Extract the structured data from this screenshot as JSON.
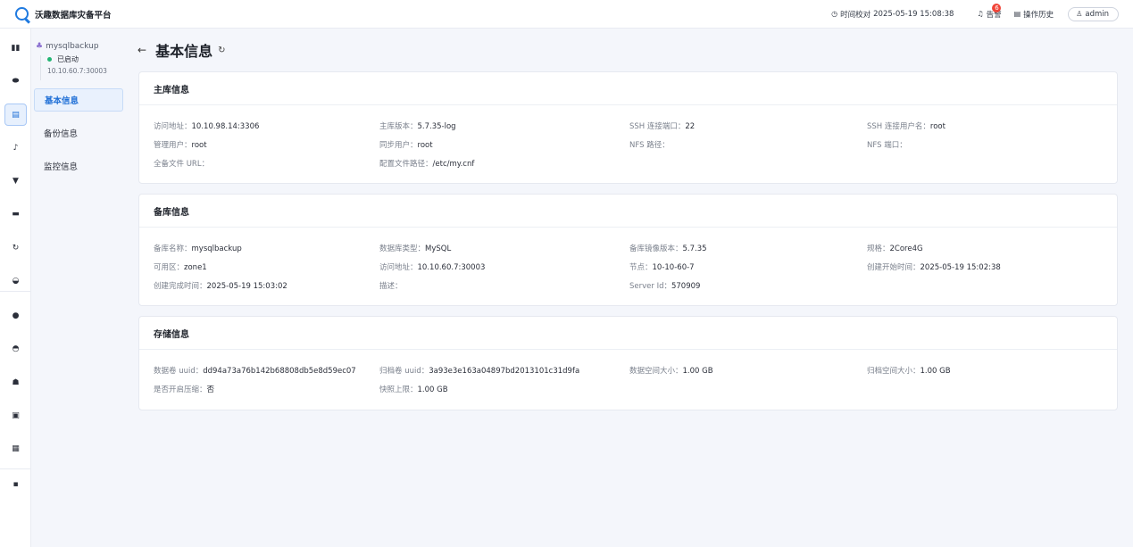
{
  "app": {
    "title": "沃趣数据库灾备平台",
    "time_label": "时间校对",
    "time_value": "2025-05-19 15:08:38",
    "alarm_label": "告警",
    "alarm_count": "6",
    "history_label": "操作历史",
    "user": "admin"
  },
  "instance": {
    "name": "mysqlbackup",
    "status": "已启动",
    "address": "10.10.60.7:30003"
  },
  "subnav": {
    "items": [
      {
        "label": "基本信息"
      },
      {
        "label": "备份信息"
      },
      {
        "label": "监控信息"
      }
    ]
  },
  "page": {
    "title": "基本信息"
  },
  "primary": {
    "title": "主库信息",
    "fields": [
      {
        "k": "访问地址：",
        "v": "10.10.98.14:3306"
      },
      {
        "k": "主库版本：",
        "v": "5.7.35-log"
      },
      {
        "k": "SSH 连接端口：",
        "v": "22"
      },
      {
        "k": "SSH 连接用户名：",
        "v": "root"
      },
      {
        "k": "管理用户：",
        "v": "root"
      },
      {
        "k": "同步用户：",
        "v": "root"
      },
      {
        "k": "NFS 路径：",
        "v": ""
      },
      {
        "k": "NFS 端口：",
        "v": ""
      },
      {
        "k": "全备文件 URL：",
        "v": ""
      },
      {
        "k": "配置文件路径：",
        "v": "/etc/my.cnf"
      }
    ]
  },
  "standby": {
    "title": "备库信息",
    "fields": [
      {
        "k": "备库名称：",
        "v": "mysqlbackup"
      },
      {
        "k": "数据库类型：",
        "v": "MySQL"
      },
      {
        "k": "备库镜像版本：",
        "v": "5.7.35"
      },
      {
        "k": "规格：",
        "v": "2Core4G"
      },
      {
        "k": "可用区：",
        "v": "zone1"
      },
      {
        "k": "访问地址：",
        "v": "10.10.60.7:30003"
      },
      {
        "k": "节点：",
        "v": "10-10-60-7"
      },
      {
        "k": "创建开始时间：",
        "v": "2025-05-19 15:02:38"
      },
      {
        "k": "创建完成时间：",
        "v": "2025-05-19 15:03:02"
      },
      {
        "k": "描述：",
        "v": ""
      },
      {
        "k": "Server Id：",
        "v": "570909"
      }
    ]
  },
  "storage": {
    "title": "存储信息",
    "fields": [
      {
        "k": "数据卷 uuid：",
        "v": "dd94a73a76b142b68808db5e8d59ec07"
      },
      {
        "k": "归档卷 uuid：",
        "v": "3a93e3e163a04897bd2013101c31d9fa"
      },
      {
        "k": "数据空间大小：",
        "v": "1.00 GB"
      },
      {
        "k": "归档空间大小：",
        "v": "1.00 GB"
      },
      {
        "k": "是否开启压缩：",
        "v": "否"
      },
      {
        "k": "快照上限：",
        "v": "1.00 GB"
      }
    ]
  },
  "icons": {
    "rail": [
      "bar-chart-icon",
      "database-icon",
      "document-icon",
      "music-note-icon",
      "chat-icon",
      "truck-icon",
      "redo-icon",
      "gauge-icon",
      "location-pin-icon",
      "half-circle-icon",
      "user-icon",
      "calendar-icon",
      "clipboard-icon",
      "monitor-icon"
    ]
  }
}
